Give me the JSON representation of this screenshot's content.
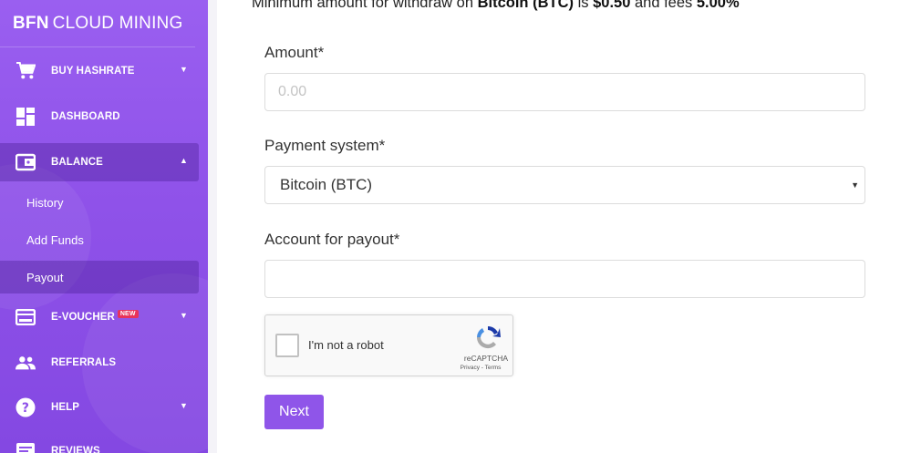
{
  "brand": {
    "bold": "BFN",
    "rest": "CLOUD MINING"
  },
  "nav": {
    "buy_hashrate": "BUY HASHRATE",
    "dashboard": "DASHBOARD",
    "balance": "BALANCE",
    "sub": {
      "history": "History",
      "add_funds": "Add Funds",
      "payout": "Payout"
    },
    "evoucher": "E-VOUCHER",
    "evoucher_badge": "NEW",
    "referrals": "REFERRALS",
    "help": "HELP",
    "reviews": "REVIEWS"
  },
  "notice": {
    "prefix": "Minimum amount for withdraw on ",
    "currency": "Bitcoin (BTC)",
    "mid": " is ",
    "amount": "$0.50",
    "mid2": " and fees ",
    "fee": "5.00%"
  },
  "form": {
    "amount_label": "Amount*",
    "amount_placeholder": "0.00",
    "payment_label": "Payment system*",
    "payment_value": "Bitcoin (BTC)",
    "account_label": "Account for payout*",
    "account_value": ""
  },
  "captcha": {
    "label": "I'm not a robot",
    "brand": "reCAPTCHA",
    "links": "Privacy - Terms"
  },
  "next_button": "Next",
  "colors": {
    "sidebar": "#8f52e9",
    "button": "#8f55e9",
    "badge": "#e8335a"
  }
}
